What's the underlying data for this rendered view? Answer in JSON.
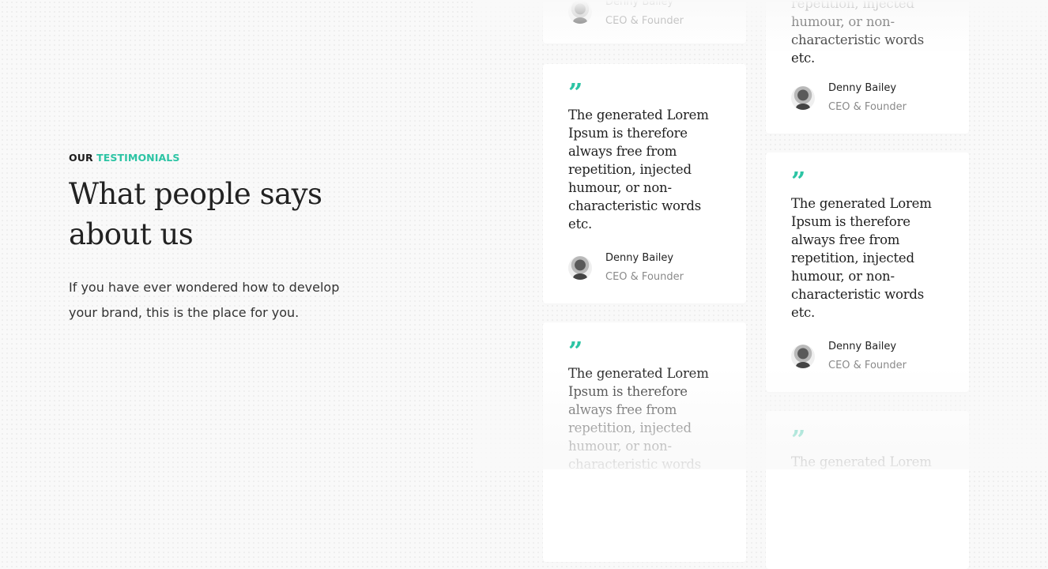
{
  "section": {
    "eyebrow_prefix": "OUR",
    "eyebrow_accent": "TESTIMONIALS",
    "heading_line1": "What people says",
    "heading_line2": "about us",
    "description": "If you have ever wondered how to develop your brand, this is the place for you."
  },
  "colors": {
    "accent": "#2cc4a4",
    "background": "#f9f9f9",
    "card": "#ffffff",
    "muted_text": "#8a8a8a"
  },
  "testimonials": {
    "column1": [
      {
        "quote_icon": "quote-icon",
        "text": "",
        "author": "Denny Bailey",
        "role": "CEO & Founder"
      },
      {
        "quote_icon": "quote-icon",
        "text": "The generated Lorem Ipsum is therefore always free from repetition, injected humour, or non-characteristic words etc.",
        "author": "Denny Bailey",
        "role": "CEO & Founder"
      },
      {
        "quote_icon": "quote-icon",
        "text": "The generated Lorem Ipsum is therefore always free from repetition, injected humour, or non-characteristic words",
        "author": "",
        "role": ""
      }
    ],
    "column2": [
      {
        "quote_icon": "quote-icon",
        "text": "repetition, injected humour, or non-characteristic words etc.",
        "author": "Denny Bailey",
        "role": "CEO & Founder"
      },
      {
        "quote_icon": "quote-icon",
        "text": "The generated Lorem Ipsum is therefore always free from repetition, injected humour, or non-characteristic words etc.",
        "author": "Denny Bailey",
        "role": "CEO & Founder"
      },
      {
        "quote_icon": "quote-icon",
        "text": "The generated Lorem",
        "author": "",
        "role": ""
      }
    ]
  }
}
